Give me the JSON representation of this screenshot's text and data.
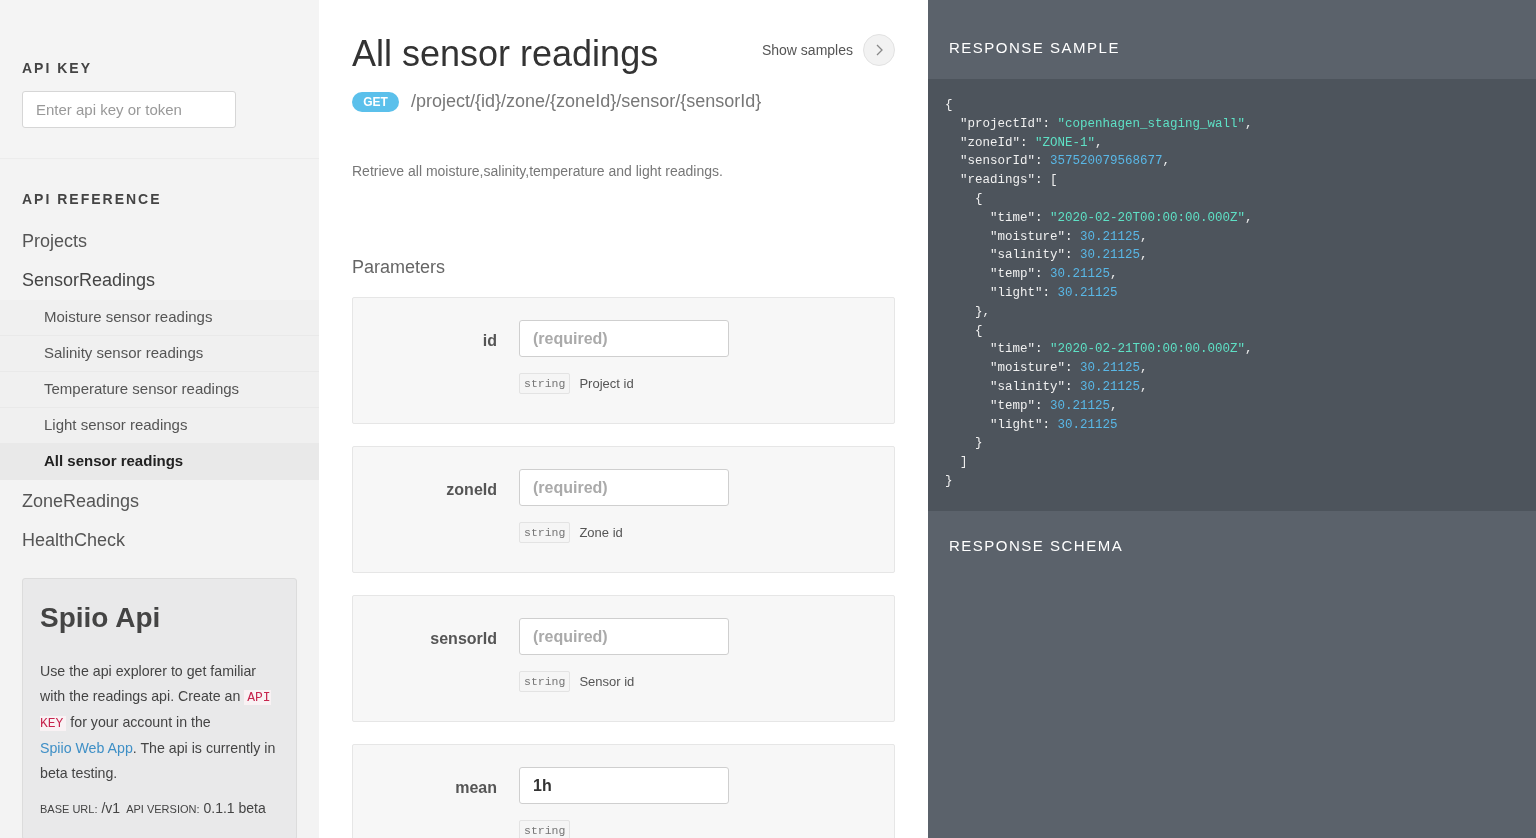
{
  "sidebar": {
    "api_key": {
      "heading": "API KEY",
      "placeholder": "Enter api key or token"
    },
    "reference_heading": "API REFERENCE",
    "nav": [
      {
        "label": "Projects",
        "expanded": false
      },
      {
        "label": "SensorReadings",
        "expanded": true,
        "children": [
          {
            "label": "Moisture sensor readings",
            "selected": false
          },
          {
            "label": "Salinity sensor readings",
            "selected": false
          },
          {
            "label": "Temperature sensor readings",
            "selected": false
          },
          {
            "label": "Light sensor readings",
            "selected": false
          },
          {
            "label": "All sensor readings",
            "selected": true
          }
        ]
      },
      {
        "label": "ZoneReadings",
        "expanded": false
      },
      {
        "label": "HealthCheck",
        "expanded": false
      }
    ],
    "info_card": {
      "title": "Spiio Api",
      "description": [
        {
          "kind": "text",
          "text": "Use the api explorer to get familiar with the readings api. Create an "
        },
        {
          "kind": "code",
          "text": "API KEY"
        },
        {
          "kind": "text",
          "text": " for your account in the "
        },
        {
          "kind": "link",
          "text": "Spiio Web App"
        },
        {
          "kind": "text",
          "text": ". The api is currently in beta testing."
        }
      ],
      "meta": [
        {
          "label": "BASE URL:",
          "value": "/v1"
        },
        {
          "label": "API VERSION:",
          "value": "0.1.1 beta"
        }
      ]
    }
  },
  "endpoint": {
    "title": "All sensor readings",
    "show_samples": "Show samples",
    "method": "GET",
    "path": "/project/{id}/zone/{zoneId}/sensor/{sensorId}",
    "description": "Retrieve all moisture,salinity,temperature and light readings.",
    "parameters_heading": "Parameters",
    "parameters": [
      {
        "name": "id",
        "placeholder": "(required)",
        "type": "string",
        "description": "Project id"
      },
      {
        "name": "zoneId",
        "placeholder": "(required)",
        "type": "string",
        "description": "Zone id"
      },
      {
        "name": "sensorId",
        "placeholder": "(required)",
        "type": "string",
        "description": "Sensor id"
      },
      {
        "name": "mean",
        "value": "1h",
        "type": "string"
      }
    ]
  },
  "response": {
    "sample_heading": "RESPONSE SAMPLE",
    "schema_heading": "RESPONSE SCHEMA",
    "code_lines": [
      [
        {
          "kind": "punct",
          "text": "{"
        }
      ],
      [
        {
          "kind": "key",
          "text": "  \"projectId\": "
        },
        {
          "kind": "string",
          "text": "\"copenhagen_staging_wall\""
        },
        {
          "kind": "punct",
          "text": ","
        }
      ],
      [
        {
          "kind": "key",
          "text": "  \"zoneId\": "
        },
        {
          "kind": "string",
          "text": "\"ZONE-1\""
        },
        {
          "kind": "punct",
          "text": ","
        }
      ],
      [
        {
          "kind": "key",
          "text": "  \"sensorId\": "
        },
        {
          "kind": "number",
          "text": "357520079568677"
        },
        {
          "kind": "punct",
          "text": ","
        }
      ],
      [
        {
          "kind": "key",
          "text": "  \"readings\": ["
        }
      ],
      [
        {
          "kind": "punct",
          "text": "    {"
        }
      ],
      [
        {
          "kind": "key",
          "text": "      \"time\": "
        },
        {
          "kind": "string",
          "text": "\"2020-02-20T00:00:00.000Z\""
        },
        {
          "kind": "punct",
          "text": ","
        }
      ],
      [
        {
          "kind": "key",
          "text": "      \"moisture\": "
        },
        {
          "kind": "number",
          "text": "30.21125"
        },
        {
          "kind": "punct",
          "text": ","
        }
      ],
      [
        {
          "kind": "key",
          "text": "      \"salinity\": "
        },
        {
          "kind": "number",
          "text": "30.21125"
        },
        {
          "kind": "punct",
          "text": ","
        }
      ],
      [
        {
          "kind": "key",
          "text": "      \"temp\": "
        },
        {
          "kind": "number",
          "text": "30.21125"
        },
        {
          "kind": "punct",
          "text": ","
        }
      ],
      [
        {
          "kind": "key",
          "text": "      \"light\": "
        },
        {
          "kind": "number",
          "text": "30.21125"
        }
      ],
      [
        {
          "kind": "punct",
          "text": "    },"
        }
      ],
      [
        {
          "kind": "punct",
          "text": "    {"
        }
      ],
      [
        {
          "kind": "key",
          "text": "      \"time\": "
        },
        {
          "kind": "string",
          "text": "\"2020-02-21T00:00:00.000Z\""
        },
        {
          "kind": "punct",
          "text": ","
        }
      ],
      [
        {
          "kind": "key",
          "text": "      \"moisture\": "
        },
        {
          "kind": "number",
          "text": "30.21125"
        },
        {
          "kind": "punct",
          "text": ","
        }
      ],
      [
        {
          "kind": "key",
          "text": "      \"salinity\": "
        },
        {
          "kind": "number",
          "text": "30.21125"
        },
        {
          "kind": "punct",
          "text": ","
        }
      ],
      [
        {
          "kind": "key",
          "text": "      \"temp\": "
        },
        {
          "kind": "number",
          "text": "30.21125"
        },
        {
          "kind": "punct",
          "text": ","
        }
      ],
      [
        {
          "kind": "key",
          "text": "      \"light\": "
        },
        {
          "kind": "number",
          "text": "30.21125"
        }
      ],
      [
        {
          "kind": "punct",
          "text": "    }"
        }
      ],
      [
        {
          "kind": "punct",
          "text": "  ]"
        }
      ],
      [
        {
          "kind": "punct",
          "text": "}"
        }
      ]
    ]
  }
}
